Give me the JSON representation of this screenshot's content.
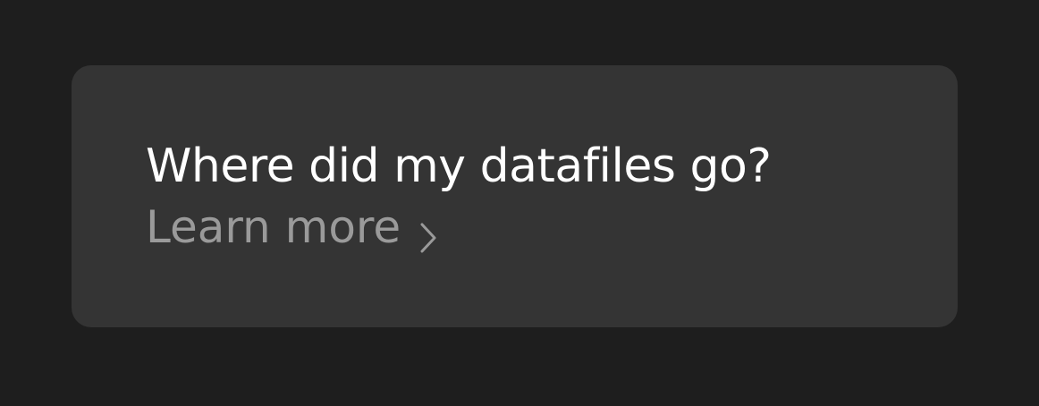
{
  "card": {
    "title": "Where did my datafiles go?",
    "link_label": "Learn more",
    "link_icon": "chevron-right-icon"
  },
  "colors": {
    "page_background": "#1e1e1e",
    "card_background": "#343434",
    "title_text": "#ffffff",
    "link_text": "#9a9a9a"
  }
}
